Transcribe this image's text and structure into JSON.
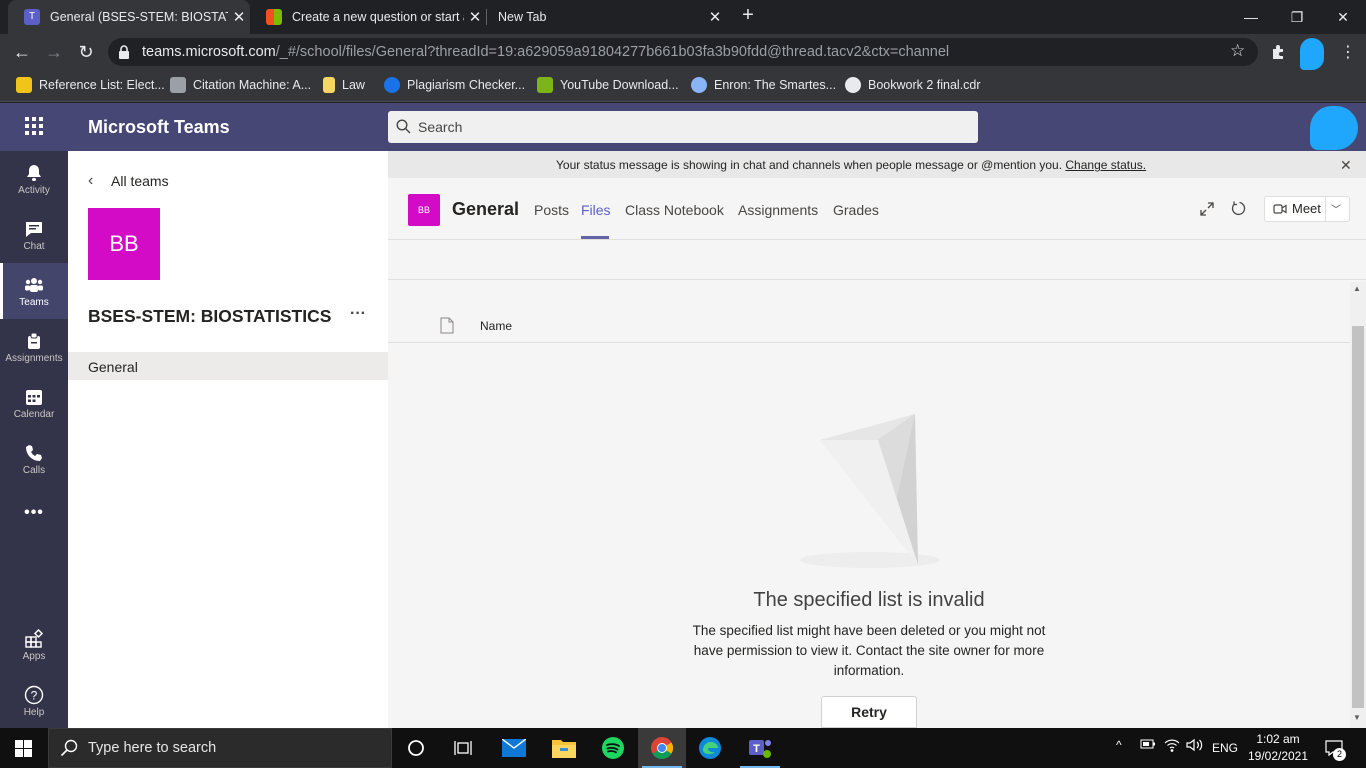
{
  "browser": {
    "tabs": [
      {
        "title": "General (BSES-STEM: BIOSTATISTICS)",
        "close": "✕"
      },
      {
        "title": "Create a new question or start a discussion",
        "close": "✕"
      },
      {
        "title": "New Tab",
        "close": "✕"
      }
    ],
    "new_tab": "+",
    "window_controls": {
      "minimize": "—",
      "restore": "❐",
      "close": "✕"
    },
    "url_host": "teams.microsoft.com",
    "url_path": "/_#/school/files/General?threadId=19:a629059a91804277b661b03fa3b90fdd@thread.tacv2&ctx=channel",
    "bookmarks": [
      {
        "label": "Reference List: Elect...",
        "icon": "cla-icon",
        "color": "#f0c419"
      },
      {
        "label": "Citation Machine: A...",
        "icon": "citation-icon",
        "color": "#9aa0a6"
      },
      {
        "label": "Law",
        "icon": "folder-icon",
        "color": "#f6d565"
      },
      {
        "label": "Plagiarism Checker...",
        "icon": "plagiarism-icon",
        "color": "#1a73e8"
      },
      {
        "label": "YouTube Download...",
        "icon": "download-icon",
        "color": "#7cb518"
      },
      {
        "label": "Enron: The Smartes...",
        "icon": "enron-icon",
        "color": "#8ab4f8"
      },
      {
        "label": "Bookwork 2 final.cdr",
        "icon": "globe-icon",
        "color": "#e8eaed"
      }
    ]
  },
  "teams": {
    "app_title": "Microsoft Teams",
    "search_placeholder": "Search",
    "rail": [
      {
        "label": "Activity",
        "icon": "bell-icon"
      },
      {
        "label": "Chat",
        "icon": "chat-icon"
      },
      {
        "label": "Teams",
        "icon": "teams-icon"
      },
      {
        "label": "Assignments",
        "icon": "assignments-icon"
      },
      {
        "label": "Calendar",
        "icon": "calendar-icon"
      },
      {
        "label": "Calls",
        "icon": "phone-icon"
      },
      {
        "label": "•••",
        "icon": "more-icon"
      },
      {
        "label": "Apps",
        "icon": "apps-icon"
      },
      {
        "label": "Help",
        "icon": "help-icon"
      }
    ],
    "panel": {
      "back_label": "All teams",
      "team_initials": "BB",
      "team_name": "BSES-STEM: BIOSTATISTICS",
      "more": "···",
      "channel": "General"
    },
    "banner": {
      "text": "Your status message is showing in chat and channels when people message or @mention you.",
      "link": "Change status.",
      "close": "✕"
    },
    "channel": {
      "initials": "BB",
      "name": "General",
      "tabs": [
        "Posts",
        "Files",
        "Class Notebook",
        "Assignments",
        "Grades"
      ],
      "meet_label": "Meet"
    },
    "files": {
      "column_name": "Name",
      "error_title": "The specified list is invalid",
      "error_body": "The specified list might have been deleted or you might not have permission to view it. Contact the site owner for more information.",
      "retry_label": "Retry"
    }
  },
  "taskbar": {
    "search_placeholder": "Type here to search",
    "language": "ENG",
    "time": "1:02 am",
    "date": "19/02/2021",
    "notifications": "2"
  },
  "colors": {
    "teams_purple": "#464775",
    "rail": "#33344a",
    "team_tile": "#d40bc6",
    "accent": "#6264a7"
  }
}
